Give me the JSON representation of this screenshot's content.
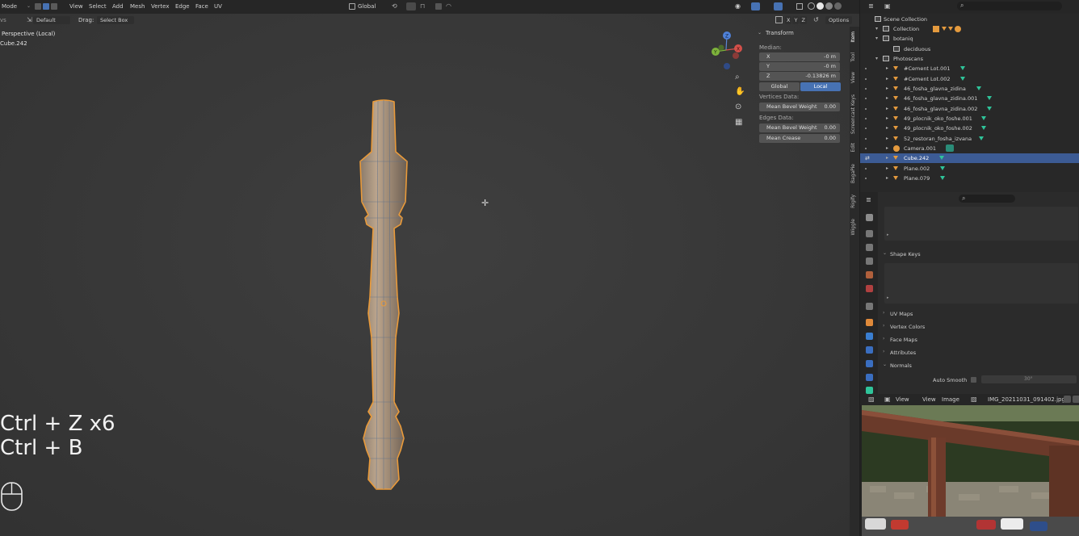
{
  "viewport": {
    "header": {
      "mode": "Mode",
      "menus": [
        "View",
        "Select",
        "Add",
        "Mesh",
        "Vertex",
        "Edge",
        "Face",
        "UV"
      ],
      "orientation": "Global",
      "options": "Options",
      "axes": [
        "X",
        "Y",
        "Z"
      ]
    },
    "tool_header": {
      "label_prefix": "vs",
      "orient_value": "Default",
      "drag_label": "Drag:",
      "drag_value": "Select Box"
    },
    "info_line1": "Perspective (Local)",
    "info_line2": "Cube.242",
    "shortcut_line1": "Ctrl + Z x6",
    "shortcut_line2": "Ctrl + B",
    "gizmo": {
      "x": "X",
      "y": "Y",
      "z": "Z"
    }
  },
  "npanel": {
    "title": "Transform",
    "median_label": "Median:",
    "fields": [
      {
        "label": "X",
        "value": "-0 m"
      },
      {
        "label": "Y",
        "value": "-0 m"
      },
      {
        "label": "Z",
        "value": "-0.13826 m"
      }
    ],
    "global_btn": "Global",
    "local_btn": "Local",
    "vertices_label": "Vertices Data:",
    "vert_bevel_label": "Mean Bevel Weight",
    "vert_bevel_value": "0.00",
    "edges_label": "Edges Data:",
    "edge_bevel_label": "Mean Bevel Weight",
    "edge_bevel_value": "0.00",
    "crease_label": "Mean Crease",
    "crease_value": "0.00",
    "tabs": [
      "Item",
      "Tool",
      "View",
      "Screencast Keys",
      "Edit",
      "BagaPie",
      "Rigify",
      "Wiggle"
    ]
  },
  "outliner": {
    "scene_collection": "Scene Collection",
    "collection": "Collection",
    "botaniq": "botaniq",
    "deciduous": "deciduous",
    "photoscans": "Photoscans",
    "items": [
      "#Cement Lot.001",
      "#Cement Lot.002",
      "46_fosha_glavna_zidina",
      "46_fosha_glavna_zidina.001",
      "46_fosha_glavna_zidina.002",
      "49_plocnik_oko_foshe.001",
      "49_plocnik_oko_foshe.002",
      "52_restoran_fosha_izvana",
      "Camera.001",
      "Cube.242",
      "Plane.002",
      "Plane.079"
    ],
    "selected_index": 9,
    "accent": "#3c5b94"
  },
  "properties": {
    "shape_keys": "Shape Keys",
    "uv_maps": "UV Maps",
    "vertex_colors": "Vertex Colors",
    "face_maps": "Face Maps",
    "attributes": "Attributes",
    "normals": "Normals",
    "auto_smooth": "Auto Smooth",
    "auto_smooth_angle": "30°"
  },
  "image_editor": {
    "view_menu": "View",
    "view2": "View",
    "image_menu": "Image",
    "image_name": "IMG_20211031_091402.jpg"
  }
}
